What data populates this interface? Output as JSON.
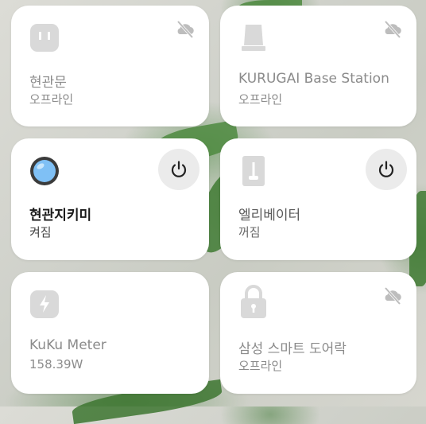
{
  "devices": [
    {
      "name": "현관문",
      "status": "오프라인",
      "icon": "door-lock-icon",
      "offline": true
    },
    {
      "name": "KURUGAI Base Station",
      "status": "오프라인",
      "icon": "hub-icon",
      "offline": true
    },
    {
      "name": "현관지키미",
      "status": "켜짐",
      "icon": "camera-icon",
      "offline": false
    },
    {
      "name": "엘리베이터",
      "status": "꺼짐",
      "icon": "switch-icon",
      "offline": false
    },
    {
      "name": "KuKu Meter",
      "status": "158.39W",
      "icon": "power-meter-icon",
      "offline": false
    },
    {
      "name": "삼성 스마트 도어락",
      "status": "오프라인",
      "icon": "padlock-icon",
      "offline": true
    }
  ],
  "colors": {
    "icon_gray": "#d9d9d9",
    "text_dim": "#8b8b8b",
    "text_dark": "#1b1b1b",
    "camera_lens": "#7fc0f5"
  }
}
